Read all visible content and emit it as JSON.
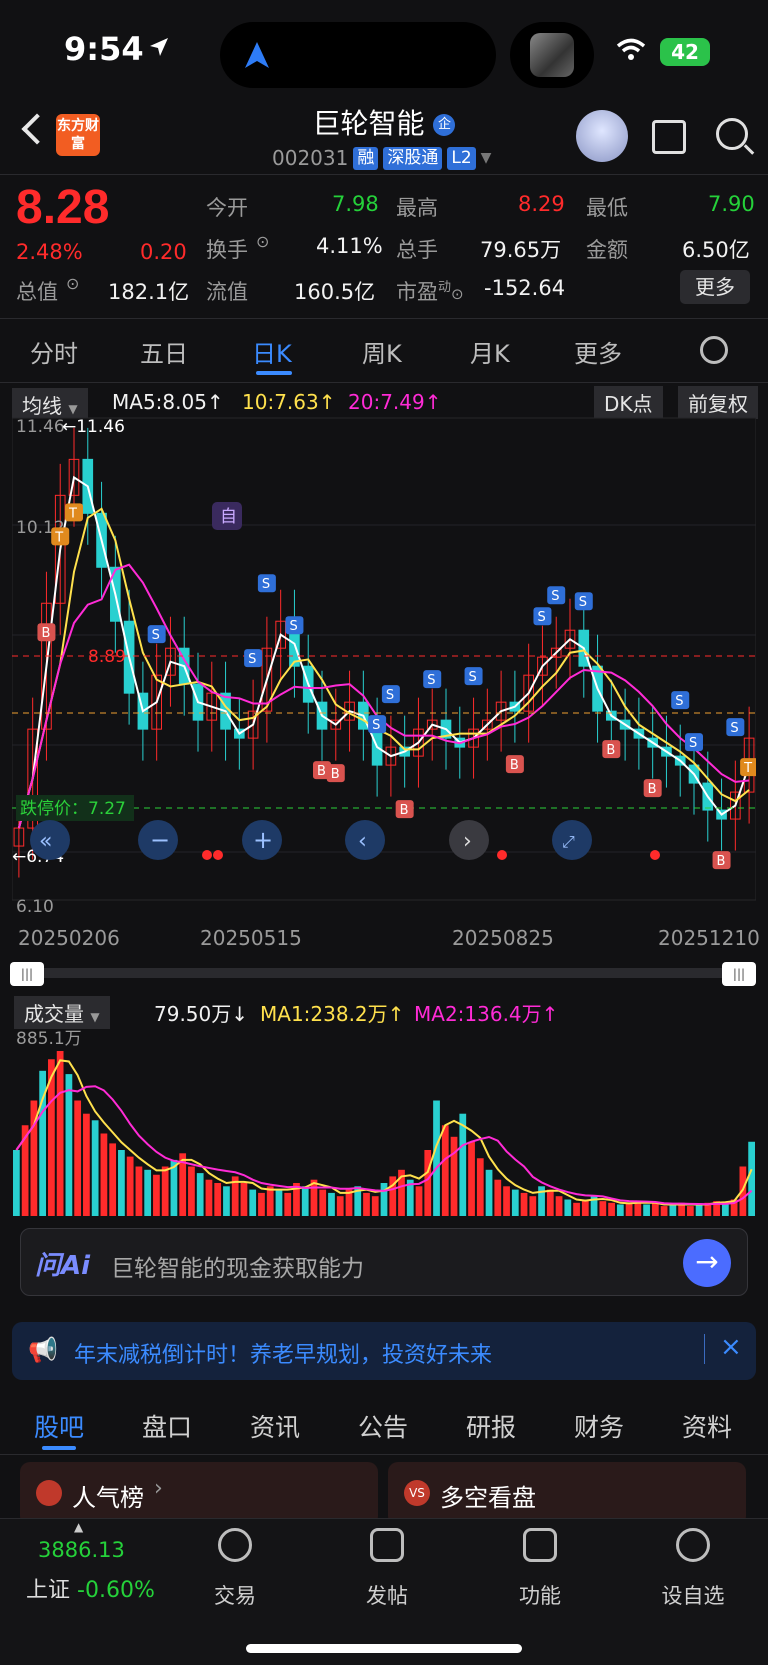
{
  "status": {
    "time": "9:54",
    "battery": "42"
  },
  "header": {
    "logo": "东方财富",
    "stock_name": "巨轮智能",
    "name_badge": "企",
    "code": "002031",
    "tags": [
      "融",
      "深股通",
      "L2"
    ]
  },
  "quote": {
    "price": "8.28",
    "change_pct": "2.48%",
    "change": "0.20",
    "items": [
      {
        "label": "今开",
        "value": "7.98",
        "color": "green"
      },
      {
        "label": "最高",
        "value": "8.29",
        "color": "red"
      },
      {
        "label": "最低",
        "value": "7.90",
        "color": "green"
      },
      {
        "label": "换手",
        "value": "4.11%",
        "color": "white"
      },
      {
        "label": "总手",
        "value": "79.65万",
        "color": "white"
      },
      {
        "label": "金额",
        "value": "6.50亿",
        "color": "white"
      },
      {
        "label": "总值",
        "value": "182.1亿",
        "color": "white"
      },
      {
        "label": "流值",
        "value": "160.5亿",
        "color": "white"
      },
      {
        "label": "市盈",
        "value": "-152.64",
        "color": "white"
      }
    ],
    "pe_sup": "动",
    "more": "更多"
  },
  "tabs": [
    "分时",
    "五日",
    "日K",
    "周K",
    "月K",
    "更多"
  ],
  "active_tab": "日K",
  "chart": {
    "ma_selector": "均线",
    "ma5": "MA5:8.05↑",
    "ma10": "10:7.63↑",
    "ma20": "20:7.49↑",
    "dk": "DK点",
    "adjust": "前复权",
    "y_top": "11.46",
    "y_mid": "10.12",
    "y_bottom": "6.10",
    "high_label": "←11.46",
    "low_label": "←6.74",
    "red_level": "8.89",
    "stop_label": "跌停价：7.27",
    "self_tag": "自",
    "dates": [
      "20250206",
      "20250515",
      "20250825",
      "20251210"
    ]
  },
  "chart_data": {
    "type": "line",
    "x": [
      "20250206",
      "20250515",
      "20250825",
      "20251210"
    ],
    "ylim": [
      6.1,
      11.46
    ],
    "series": [
      {
        "name": "MA5",
        "last": 8.05
      },
      {
        "name": "MA10",
        "last": 7.63
      },
      {
        "name": "MA20",
        "last": 7.49
      }
    ],
    "annotations": {
      "high": 11.46,
      "low": 6.74,
      "limit_down": 7.27,
      "price_line": 8.89
    },
    "close_points": [
      6.9,
      8.0,
      9.4,
      10.6,
      11.0,
      10.4,
      9.8,
      9.2,
      8.4,
      8.0,
      8.6,
      8.9,
      8.5,
      8.1,
      8.4,
      8.0,
      7.9,
      8.2,
      8.9,
      9.2,
      8.7,
      8.3,
      8.0,
      8.1,
      8.3,
      8.0,
      7.6,
      7.8,
      7.7,
      8.0,
      8.1,
      7.9,
      7.8,
      8.0,
      8.1,
      8.3,
      8.2,
      8.6,
      8.8,
      8.9,
      9.1,
      8.7,
      8.2,
      8.1,
      8.0,
      7.9,
      7.8,
      7.7,
      7.6,
      7.4,
      7.1,
      7.0,
      7.3,
      7.9
    ]
  },
  "volume": {
    "selector": "成交量",
    "value": "79.50万↓",
    "ma1": "MA1:238.2万↑",
    "ma2": "MA2:136.4万↑",
    "ymax": "885.1万",
    "bars": [
      40,
      55,
      70,
      88,
      95,
      100,
      86,
      70,
      62,
      58,
      50,
      44,
      40,
      36,
      30,
      28,
      25,
      30,
      34,
      38,
      30,
      26,
      22,
      20,
      18,
      24,
      20,
      16,
      14,
      18,
      16,
      14,
      20,
      18,
      22,
      16,
      14,
      12,
      16,
      18,
      14,
      12,
      20,
      24,
      28,
      22,
      18,
      40,
      70,
      55,
      48,
      62,
      45,
      35,
      28,
      22,
      18,
      16,
      14,
      12,
      18,
      16,
      12,
      10,
      8,
      10,
      12,
      9,
      8,
      7,
      8,
      9,
      7,
      8,
      6,
      7,
      8,
      6,
      7,
      8,
      9,
      8,
      10,
      30,
      45
    ]
  },
  "ai": {
    "placeholder": "巨轮智能的现金获取能力",
    "logo": "问Ai",
    "go": "→"
  },
  "notice": {
    "text": "年末减税倒计时！养老早规划，投资好未来",
    "close": "×"
  },
  "bottom_tabs": [
    "股吧",
    "盘口",
    "资讯",
    "公告",
    "研报",
    "财务",
    "资料"
  ],
  "cards": [
    "人气榜",
    "多空看盘"
  ],
  "tabbar": {
    "index_value": "3886.13",
    "index_name": "上证",
    "index_change": "-0.60%",
    "items": [
      "交易",
      "发帖",
      "功能",
      "设自选"
    ]
  }
}
